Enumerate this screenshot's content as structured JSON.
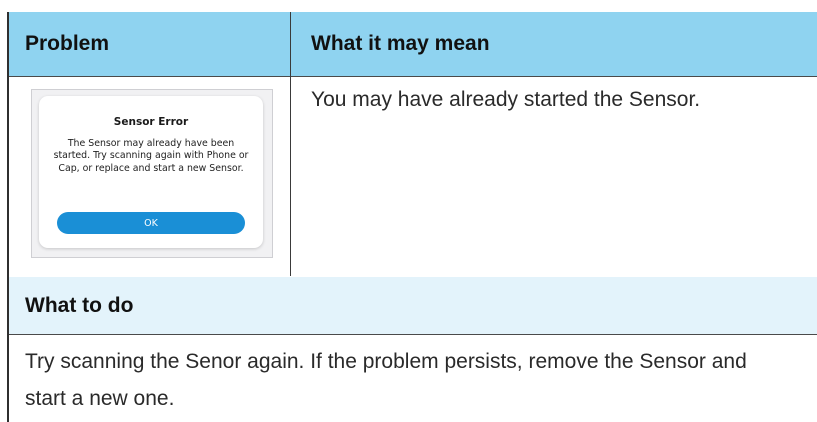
{
  "table": {
    "header_problem": "Problem",
    "header_meaning": "What it may mean",
    "meaning_text": "You may have already started the Sensor.",
    "todo_header": "What to do",
    "todo_text": "Try scanning the Senor again. If the problem persists, remove the Sensor and start a new one."
  },
  "dialog": {
    "title": "Sensor Error",
    "message": "The Sensor may already have been started. Try scanning again with Phone or Cap, or replace and start a new Sensor.",
    "ok_label": "OK"
  },
  "colors": {
    "header_bg": "#8fd3f0",
    "todo_bg": "#e3f3fb",
    "ok_button": "#1a8fd6"
  }
}
